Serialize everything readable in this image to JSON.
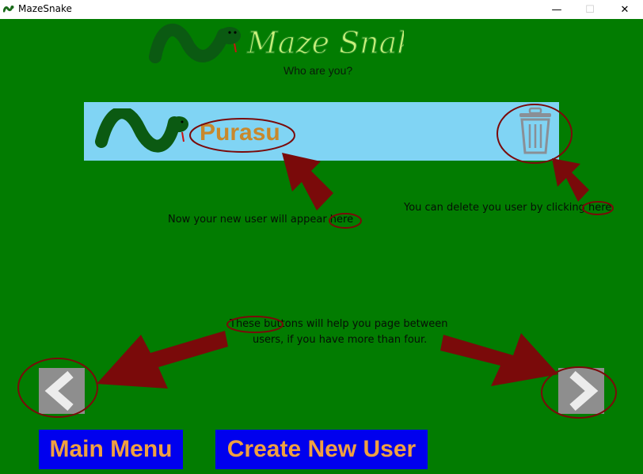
{
  "window": {
    "title": "MazeSnake",
    "minimize_glyph": "—",
    "maximize_glyph": "☐",
    "close_glyph": "✕"
  },
  "header": {
    "logo_text": "Maze Snake",
    "subtitle": "Who are you?"
  },
  "user_card": {
    "username": "Purasu",
    "background_color": "#80d4f4",
    "name_color": "#c8882c"
  },
  "annotations": {
    "new_user_note": "Now your new user will appear here",
    "delete_note": "You can delete you user by clicking here",
    "paging_note_line1": "These buttons will help you page between",
    "paging_note_line2": "users, if you have more than four."
  },
  "buttons": {
    "main_menu": "Main Menu",
    "create_new_user": "Create New User",
    "prev_icon": "chevron-left-icon",
    "next_icon": "chevron-right-icon"
  },
  "colors": {
    "game_background": "#027c01",
    "button_background": "#0000ee",
    "button_text": "#f0a040",
    "annotation": "#7a0a0a",
    "snake": "#0b5a12"
  }
}
